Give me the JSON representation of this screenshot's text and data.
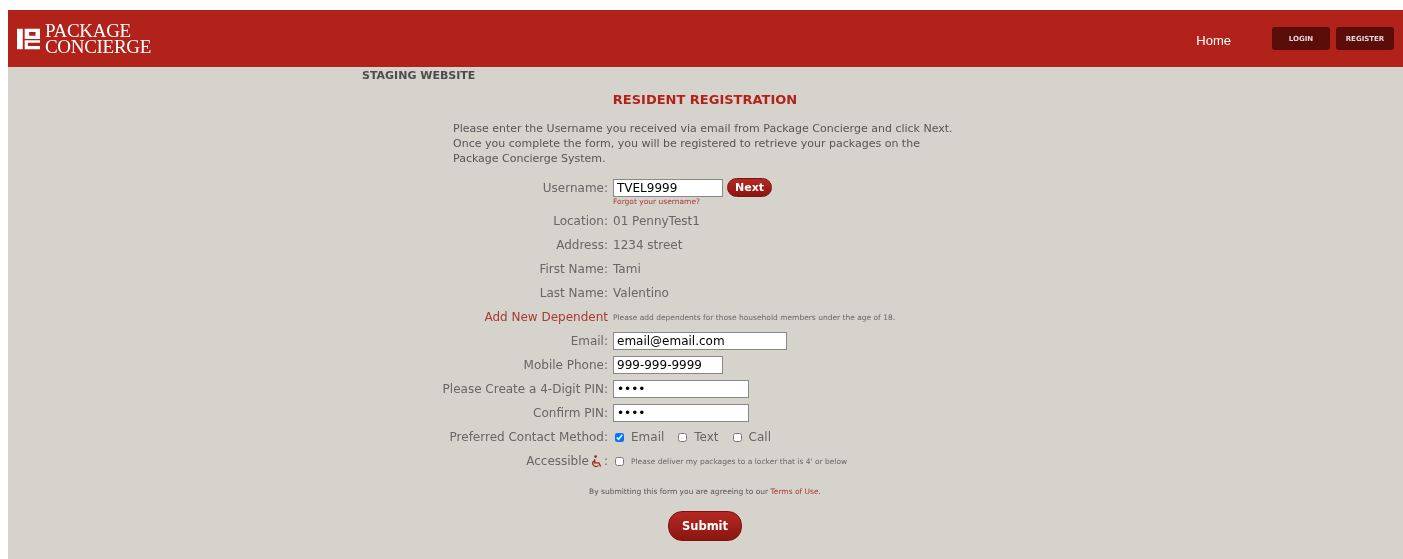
{
  "header": {
    "logo": {
      "line1": "PACKAGE",
      "line2": "CONCIERGE"
    },
    "nav": [
      {
        "kind": "link",
        "label": "Home"
      },
      {
        "kind": "button",
        "label": "LOGIN"
      },
      {
        "kind": "button",
        "label": "REGISTER"
      }
    ]
  },
  "staging_label": "STAGING WEBSITE",
  "title": "RESIDENT REGISTRATION",
  "intro": "Please enter the Username you received via email from Package Concierge and click Next. Once you complete the form, you will be registered to retrieve your packages on the Package Concierge System.",
  "form": {
    "rows": [
      {
        "kind": "field",
        "label": "Username:",
        "value": "TVEL9999",
        "button": "Next",
        "help_link": "Forgot your username?"
      },
      {
        "kind": "text",
        "label": "Location:",
        "value": "01 PennyTest1"
      },
      {
        "kind": "text",
        "label": "Address:",
        "value": "1234 street"
      },
      {
        "kind": "text",
        "label": "First Name:",
        "value": "Tami"
      },
      {
        "kind": "text",
        "label": "Last Name:",
        "value": "Valentino"
      },
      {
        "kind": "link",
        "label": "Add New Dependent",
        "note": "Please add dependents for those household members under the age of 18."
      },
      {
        "kind": "widefield",
        "label": "Email:",
        "value": "email@email.com"
      },
      {
        "kind": "field",
        "label": "Mobile Phone:",
        "value": "999-999-9999"
      },
      {
        "kind": "pinfield",
        "label": "Please Create a 4-Digit PIN:",
        "value": "••••"
      },
      {
        "kind": "pinfield",
        "label": "Confirm PIN:",
        "value": "••••"
      },
      {
        "kind": "checkboxes",
        "label": "Preferred Contact Method:",
        "options": [
          {
            "label": "Email",
            "checked": true
          },
          {
            "label": "Text",
            "checked": false
          },
          {
            "label": "Call",
            "checked": false
          }
        ]
      },
      {
        "kind": "checkbox",
        "label": "Accessible",
        "suffix": ":",
        "checked": false,
        "text": "Please deliver my packages to a locker that is 4' or below"
      }
    ],
    "terms": {
      "before": "By submitting this form you are agreeing to our ",
      "link": "Terms of Use",
      "after": "."
    },
    "submit": "Submit"
  }
}
